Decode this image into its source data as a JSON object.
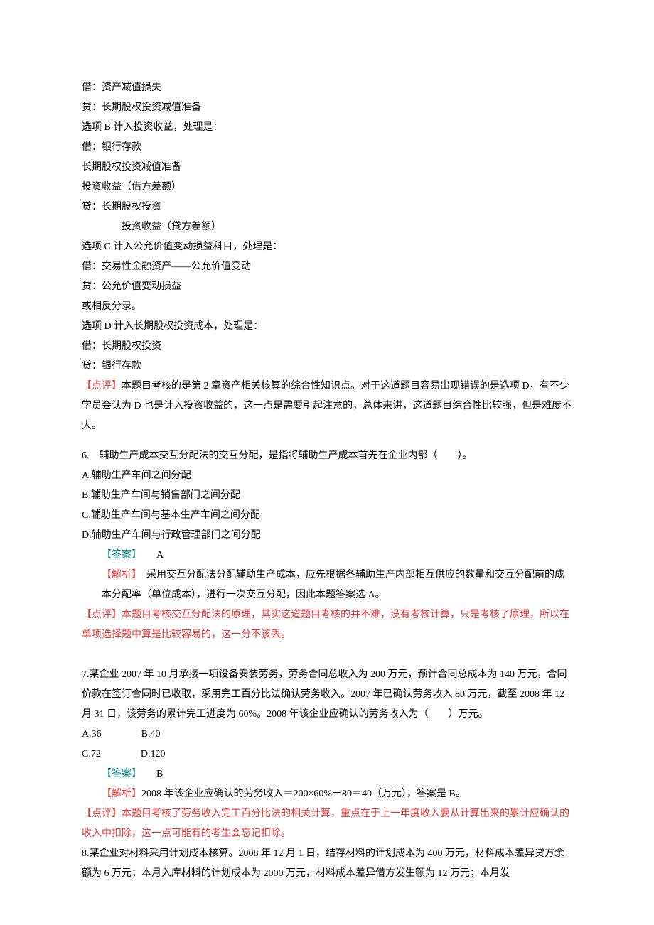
{
  "body": {
    "l01": "借：资产减值损失",
    "l02": "贷：长期股权投资减值准备",
    "l03": "选项 B 计入投资收益，处理是：",
    "l04": "借：银行存款",
    "l05": "长期股权投资减值准备",
    "l06": "投资收益（借方差额）",
    "l07": "贷：长期股权投资",
    "l08": "投资收益（贷方差额）",
    "l09": "选项 C 计入公允价值变动损益科目，处理是：",
    "l10": "借：交易性金融资产——公允价值变动",
    "l11": "贷：公允价值变动损益",
    "l12": "或相反分录。",
    "l13": "选项 D 计入长期股权投资成本，处理是：",
    "l14": "借：长期股权投资",
    "l15": "贷：银行存款",
    "dianping_label": "【点评】",
    "dianping_text1": "本题目考核的是第 2 章资产相关核算的综合性知识点。对于这道题目容易出现错误的是选项 D，有不少学员会认为 D 也是计入投资收益的，这一点是需要引起注意的，总体来讲，这道题目综合性比较强，但是难度不大。",
    "q6_stem": "6.　辅助生产成本交互分配法的交互分配，是指将辅助生产成本首先在企业内部（　　）。",
    "q6_a": "A.辅助生产车间之间分配",
    "q6_b": "B.辅助生产车间与销售部门之间分配",
    "q6_c": "C.辅助生产车间与基本生产车间之间分配",
    "q6_d": "D.辅助生产车间与行政管理部门之间分配",
    "answer_label": "【答案】",
    "q6_answer_text": "　　A",
    "jiexi_label": "【解析】",
    "q6_jiexi_text": "　采用交互分配法分配辅助生产成本，应先根据各辅助生产内部相互供应的数量和交互分配前的成本分配率（单位成本），进行一次交互分配，因此本题答案选 A。",
    "q6_dianping_text": "本题目考核交互分配法的原理，其实这道题目考核的并不难，没有考核计算，只是考核了原理，所以在单项选择题中算是比较容易的，这一分不该丢。",
    "q7_stem": "7.某企业 2007 年 10 月承接一项设备安装劳务，劳务合同总收入为 200 万元，预计合同总成本为 140 万元，合同价款在签订合同时已收取，采用完工百分比法确认劳务收入。2007 年已确认劳务收入 80 万元，截至 2008 年 12 月 31 日，该劳务的累计完工进度为 60%。2008 年该企业应确认的劳务收入为（　　）万元。",
    "q7_ab": "A.36　　　　B.40",
    "q7_cd": "C.72　　　　D.120",
    "q7_answer_text": "　　B",
    "q7_jiexi_text": "2008 年该企业应确认的劳务收入＝200×60%－80＝40（万元），答案是 B。",
    "q7_dianping_text": "本题目考核了劳务收入完工百分比法的相关计算，重点在于上一年度收入要从计算出来的累计应确认的收入中扣除，这一点可能有的考生会忘记扣除。",
    "q8_stem": "8.某企业对材料采用计划成本核算。2008 年 12 月 1 日，结存材料的计划成本为 400 万元，材料成本差异贷方余额为 6 万元；本月入库材料的计划成本为 2000 万元，材料成本差异借方发生额为 12 万元；本月发"
  }
}
